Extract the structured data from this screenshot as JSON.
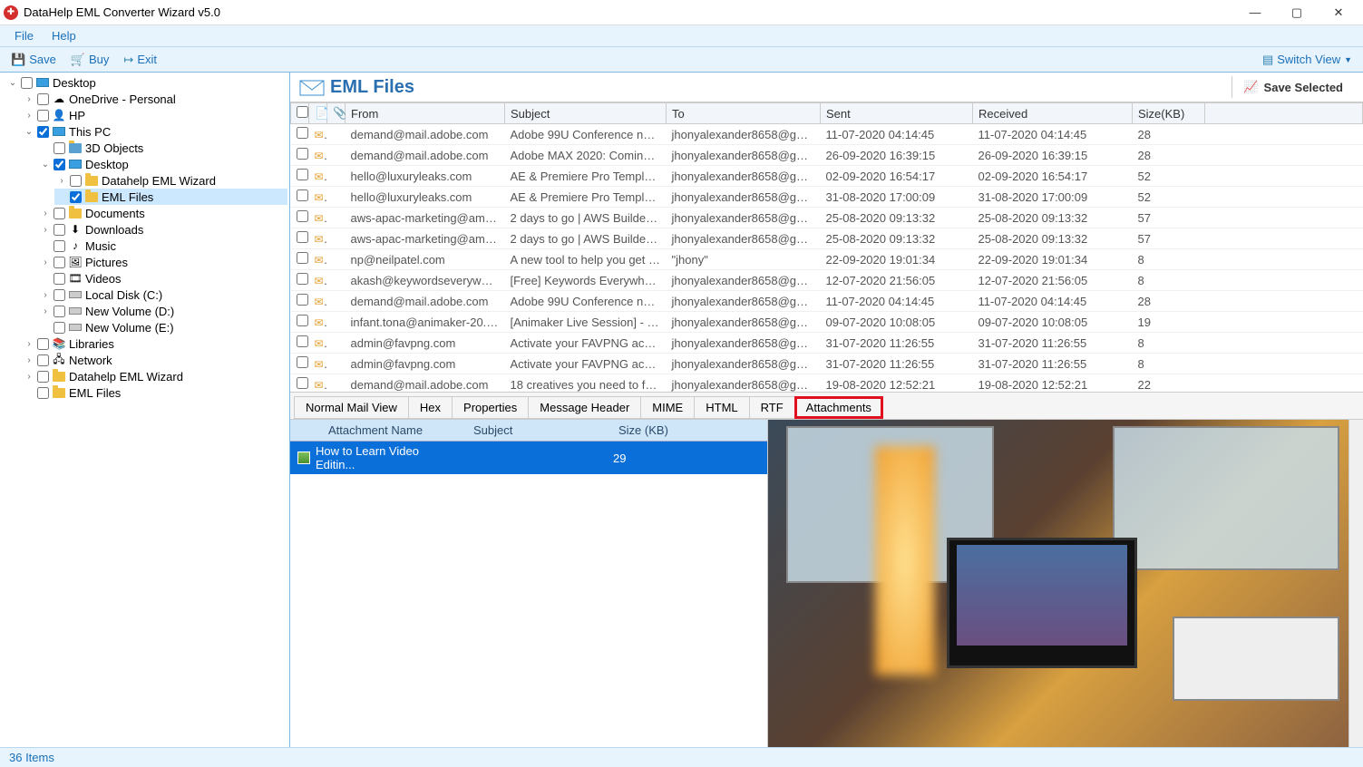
{
  "app": {
    "title": "DataHelp EML Converter Wizard v5.0"
  },
  "menubar": {
    "file": "File",
    "help": "Help"
  },
  "toolbar": {
    "save": "Save",
    "buy": "Buy",
    "exit": "Exit",
    "switch_view": "Switch View"
  },
  "tree": {
    "root": "Desktop",
    "onedrive": "OneDrive - Personal",
    "hp": "HP",
    "thispc": "This PC",
    "objects3d": "3D Objects",
    "desktop2": "Desktop",
    "datahelp_wiz": "Datahelp EML Wizard",
    "eml_files": "EML Files",
    "documents": "Documents",
    "downloads": "Downloads",
    "music": "Music",
    "pictures": "Pictures",
    "videos": "Videos",
    "local_c": "Local Disk (C:)",
    "vol_d": "New Volume (D:)",
    "vol_e": "New Volume (E:)",
    "libraries": "Libraries",
    "network": "Network",
    "datahelp_wiz2": "Datahelp EML Wizard",
    "eml_files2": "EML Files"
  },
  "eml_header": {
    "title": "EML Files",
    "save_selected": "Save Selected"
  },
  "columns": {
    "from": "From",
    "subject": "Subject",
    "to": "To",
    "sent": "Sent",
    "received": "Received",
    "size": "Size(KB)"
  },
  "emails": [
    {
      "from": "demand@mail.adobe.com",
      "subject": "Adobe 99U Conference now ...",
      "to": "jhonyalexander8658@gmail....",
      "sent": "11-07-2020 04:14:45",
      "received": "11-07-2020 04:14:45",
      "size": "28"
    },
    {
      "from": "demand@mail.adobe.com",
      "subject": "Adobe MAX 2020: Coming to ...",
      "to": "jhonyalexander8658@gmail....",
      "sent": "26-09-2020 16:39:15",
      "received": "26-09-2020 16:39:15",
      "size": "28"
    },
    {
      "from": "hello@luxuryleaks.com",
      "subject": "AE & Premiere Pro Templates ...",
      "to": "jhonyalexander8658@gmail....",
      "sent": "02-09-2020 16:54:17",
      "received": "02-09-2020 16:54:17",
      "size": "52"
    },
    {
      "from": "hello@luxuryleaks.com",
      "subject": "AE & Premiere Pro Templates ...",
      "to": "jhonyalexander8658@gmail....",
      "sent": "31-08-2020 17:00:09",
      "received": "31-08-2020 17:00:09",
      "size": "52"
    },
    {
      "from": "aws-apac-marketing@amazo...",
      "subject": "2 days to go | AWS Builders O...",
      "to": "jhonyalexander8658@gmail....",
      "sent": "25-08-2020 09:13:32",
      "received": "25-08-2020 09:13:32",
      "size": "57"
    },
    {
      "from": "aws-apac-marketing@amazo...",
      "subject": "2 days to go | AWS Builders O...",
      "to": "jhonyalexander8658@gmail....",
      "sent": "25-08-2020 09:13:32",
      "received": "25-08-2020 09:13:32",
      "size": "57"
    },
    {
      "from": "np@neilpatel.com",
      "subject": "A new tool to help you get b...",
      "to": "\"jhony\" <jhonyalexander865...",
      "sent": "22-09-2020 19:01:34",
      "received": "22-09-2020 19:01:34",
      "size": "8"
    },
    {
      "from": "akash@keywordseverywhere....",
      "subject": "[Free] Keywords Everywhere - ...",
      "to": "jhonyalexander8658@gmail....",
      "sent": "12-07-2020 21:56:05",
      "received": "12-07-2020 21:56:05",
      "size": "8"
    },
    {
      "from": "demand@mail.adobe.com",
      "subject": "Adobe 99U Conference now ...",
      "to": "jhonyalexander8658@gmail....",
      "sent": "11-07-2020 04:14:45",
      "received": "11-07-2020 04:14:45",
      "size": "28"
    },
    {
      "from": "infant.tona@animaker-20.int...",
      "subject": "[Animaker Live Session] - Crea...",
      "to": "jhonyalexander8658@gmail....",
      "sent": "09-07-2020 10:08:05",
      "received": "09-07-2020 10:08:05",
      "size": "19"
    },
    {
      "from": "admin@favpng.com",
      "subject": "Activate your FAVPNG account",
      "to": "jhonyalexander8658@gmail....",
      "sent": "31-07-2020 11:26:55",
      "received": "31-07-2020 11:26:55",
      "size": "8"
    },
    {
      "from": "admin@favpng.com",
      "subject": "Activate your FAVPNG account",
      "to": "jhonyalexander8658@gmail....",
      "sent": "31-07-2020 11:26:55",
      "received": "31-07-2020 11:26:55",
      "size": "8"
    },
    {
      "from": "demand@mail.adobe.com",
      "subject": "18 creatives you need to follo...",
      "to": "jhonyalexander8658@gmail....",
      "sent": "19-08-2020 12:52:21",
      "received": "19-08-2020 12:52:21",
      "size": "22"
    }
  ],
  "tabs": {
    "normal": "Normal Mail View",
    "hex": "Hex",
    "properties": "Properties",
    "msg_header": "Message Header",
    "mime": "MIME",
    "html": "HTML",
    "rtf": "RTF",
    "attachments": "Attachments"
  },
  "attach_cols": {
    "name": "Attachment Name",
    "subject": "Subject",
    "size": "Size (KB)"
  },
  "attachment": {
    "name": "How to Learn Video Editin...",
    "subject": "",
    "size": "29"
  },
  "statusbar": {
    "items": "36 Items"
  }
}
